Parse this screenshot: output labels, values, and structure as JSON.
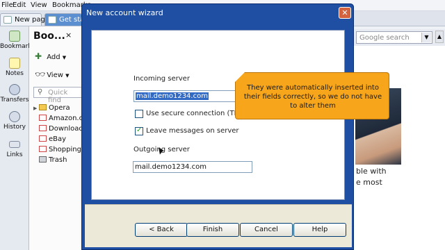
{
  "menu": [
    "File",
    "Edit",
    "View",
    "Bookmarks"
  ],
  "tabs": [
    {
      "label": "New page"
    },
    {
      "label": "Get star"
    }
  ],
  "search": {
    "placeholder": "Google search"
  },
  "sidebar": [
    {
      "label": "Bookmarks",
      "icon": "bookmarks-icon"
    },
    {
      "label": "Notes",
      "icon": "notes-icon"
    },
    {
      "label": "Transfers",
      "icon": "transfers-icon"
    },
    {
      "label": "History",
      "icon": "history-icon"
    },
    {
      "label": "Links",
      "icon": "links-icon"
    }
  ],
  "panel": {
    "title": "Boo...",
    "close": "×",
    "add_label": "Add",
    "view_label": "View",
    "quickfind_placeholder": "Quick find",
    "items": [
      {
        "label": "Opera",
        "kind": "folder"
      },
      {
        "label": "Amazon.co",
        "kind": "bookmark"
      },
      {
        "label": "Download.c",
        "kind": "bookmark"
      },
      {
        "label": "eBay",
        "kind": "bookmark"
      },
      {
        "label": "Shopping.c",
        "kind": "bookmark"
      },
      {
        "label": "Trash",
        "kind": "trash"
      }
    ]
  },
  "page": {
    "text_line1": "ble with",
    "text_line2": "e most"
  },
  "dialog": {
    "title": "New account wizard",
    "close": "✕",
    "incoming_label": "Incoming server",
    "incoming_value": "mail.demo1234.com",
    "tls_label": "Use secure connection (TLS)",
    "tls_checked": false,
    "leave_label": "Leave messages on server",
    "leave_checked": true,
    "outgoing_label": "Outgoing server",
    "outgoing_value": "mail.demo1234.com",
    "buttons": {
      "back": "< Back",
      "finish": "Finish",
      "cancel": "Cancel",
      "help": "Help"
    }
  },
  "callout": {
    "text": "They were automatically inserted into their fields correctly, so we do not have to alter them"
  },
  "colors": {
    "dialog_frame": "#1f4fa3",
    "callout": "#f7a51b",
    "selection": "#316ac5"
  }
}
